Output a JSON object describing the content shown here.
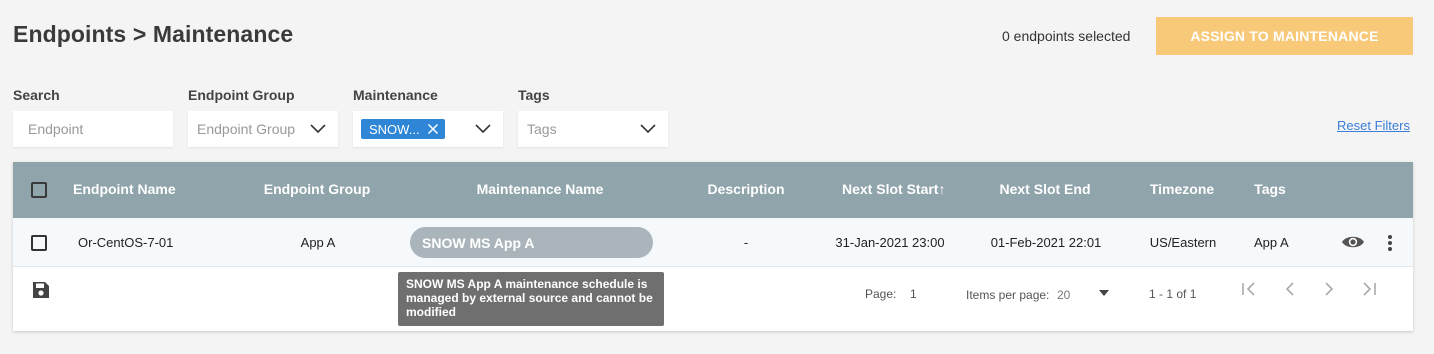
{
  "header": {
    "title": "Endpoints > Maintenance",
    "selected_count": "0 endpoints selected",
    "assign_button": "ASSIGN TO MAINTENANCE"
  },
  "filters": {
    "search": {
      "label": "Search",
      "placeholder": "Endpoint"
    },
    "endpoint_group": {
      "label": "Endpoint Group",
      "placeholder": "Endpoint Group"
    },
    "maintenance": {
      "label": "Maintenance",
      "chip": "SNOW..."
    },
    "tags": {
      "label": "Tags",
      "placeholder": "Tags"
    },
    "reset": "Reset Filters"
  },
  "table": {
    "columns": [
      "Endpoint Name",
      "Endpoint Group",
      "Maintenance Name",
      "Description",
      "Next Slot Start",
      "Next Slot End",
      "Timezone",
      "Tags"
    ],
    "sort_indicator": "↑",
    "rows": [
      {
        "endpoint_name": "Or-CentOS-7-01",
        "endpoint_group": "App A",
        "maintenance_name": "SNOW MS App A",
        "description": "-",
        "next_slot_start": "31-Jan-2021 23:00",
        "next_slot_end": "01-Feb-2021 22:01",
        "timezone": "US/Eastern",
        "tags": "App A"
      }
    ],
    "tooltip": "SNOW MS App A maintenance schedule is managed by external source and cannot be modified"
  },
  "pagination": {
    "page_label": "Page:",
    "page_value": "1",
    "items_label": "Items per page:",
    "items_value": "20",
    "range": "1 - 1 of 1"
  },
  "icons": {
    "save": "save-icon",
    "view": "eye-icon",
    "more": "more-vertical-icon",
    "first": "first-page-icon",
    "prev": "chevron-left-icon",
    "next": "chevron-right-icon",
    "last": "last-page-icon"
  },
  "colors": {
    "header_bg": "#90a4ac",
    "assign_btn": "#f8c978",
    "chip": "#2f86d6",
    "link": "#3b7dd8",
    "tooltip": "#6f6f6f"
  }
}
